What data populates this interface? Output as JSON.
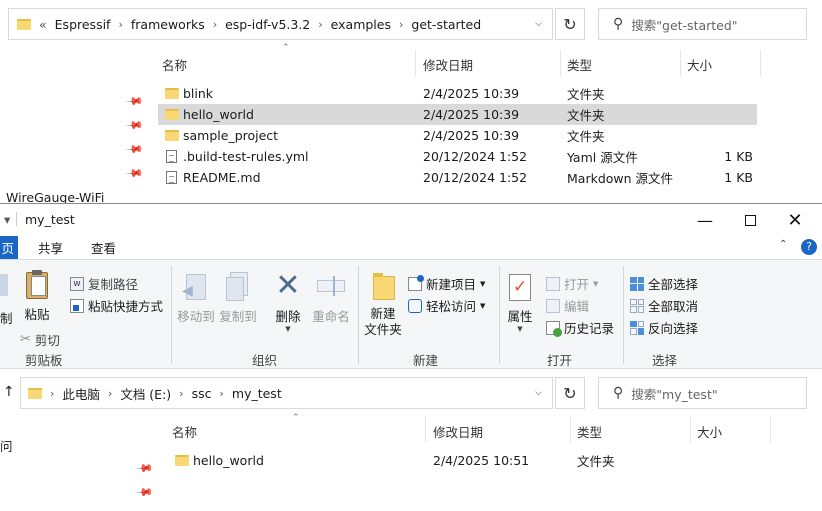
{
  "back_window": {
    "address": {
      "overflow": "«",
      "crumbs": [
        "Espressif",
        "frameworks",
        "esp-idf-v5.3.2",
        "examples",
        "get-started"
      ]
    },
    "search_placeholder": "搜索\"get-started\"",
    "columns": {
      "name": "名称",
      "date": "修改日期",
      "type": "类型",
      "size": "大小"
    },
    "sidebar_partial_item": "WireGauge-WiFi",
    "files": [
      {
        "icon": "folder-icon",
        "name": "blink",
        "date": "2/4/2025 10:39",
        "type": "文件夹",
        "size": ""
      },
      {
        "icon": "folder-icon",
        "name": "hello_world",
        "date": "2/4/2025 10:39",
        "type": "文件夹",
        "size": ""
      },
      {
        "icon": "folder-icon",
        "name": "sample_project",
        "date": "2/4/2025 10:39",
        "type": "文件夹",
        "size": ""
      },
      {
        "icon": "file-icon",
        "name": ".build-test-rules.yml",
        "date": "20/12/2024 1:52",
        "type": "Yaml 源文件",
        "size": "1 KB"
      },
      {
        "icon": "file-icon",
        "name": "README.md",
        "date": "20/12/2024 1:52",
        "type": "Markdown 源文件",
        "size": "1 KB"
      }
    ],
    "selected_index": 1
  },
  "front_window": {
    "title": "my_test",
    "tabs": {
      "file": "页",
      "share": "共享",
      "view": "查看"
    },
    "ribbon": {
      "clipboard": {
        "label": "剪贴板",
        "paste": "粘贴",
        "cut_partial": "制",
        "copy_path": "复制路径",
        "paste_shortcut": "粘贴快捷方式",
        "cut": "剪切"
      },
      "organize": {
        "label": "组织",
        "move_to": "移动到",
        "copy_to": "复制到",
        "delete": "删除",
        "rename": "重命名"
      },
      "new": {
        "label": "新建",
        "new_folder": "新建\n文件夹",
        "new_item": "新建项目",
        "easy_access": "轻松访问"
      },
      "open": {
        "label": "打开",
        "properties": "属性",
        "open": "打开",
        "edit": "编辑",
        "history": "历史记录"
      },
      "select": {
        "label": "选择",
        "select_all": "全部选择",
        "select_none": "全部取消",
        "invert": "反向选择"
      }
    },
    "address": {
      "crumbs": [
        "此电脑",
        "文档 (E:)",
        "ssc",
        "my_test"
      ]
    },
    "search_placeholder": "搜索\"my_test\"",
    "columns": {
      "name": "名称",
      "date": "修改日期",
      "type": "类型",
      "size": "大小"
    },
    "sidebar_partial_item": "问",
    "files": [
      {
        "icon": "folder-icon",
        "name": "hello_world",
        "date": "2/4/2025 10:51",
        "type": "文件夹",
        "size": ""
      }
    ]
  },
  "colors": {
    "file_tab": "#1a66c6",
    "selected_row": "#d9d9d9",
    "folder": "#f8d775",
    "ribbon_bg": "#f5f6f7"
  }
}
